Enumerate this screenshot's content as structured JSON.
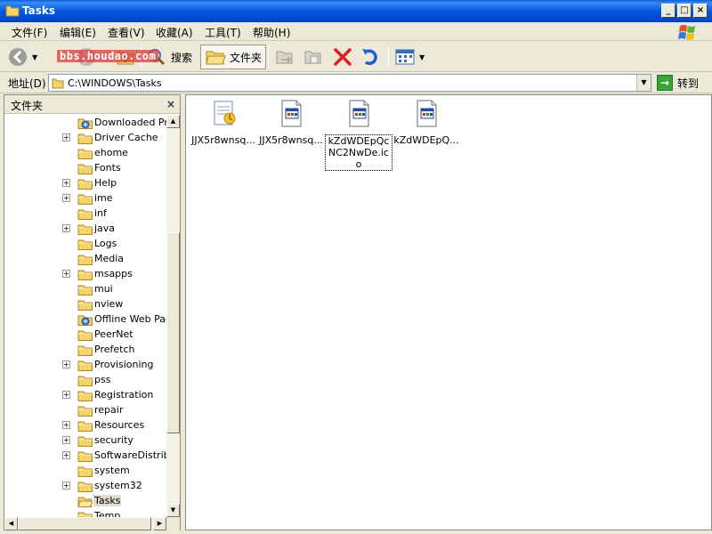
{
  "window": {
    "title": "Tasks"
  },
  "watermark": {
    "text": "bbs.houdao.com"
  },
  "menu": [
    {
      "label": "文件(F)"
    },
    {
      "label": "编辑(E)"
    },
    {
      "label": "查看(V)"
    },
    {
      "label": "收藏(A)"
    },
    {
      "label": "工具(T)"
    },
    {
      "label": "帮助(H)"
    }
  ],
  "toolbar": {
    "search_label": "搜索",
    "folders_label": "文件夹"
  },
  "address": {
    "label": "地址(D)",
    "path": "C:\\WINDOWS\\Tasks",
    "go_label": "转到"
  },
  "folder_pane": {
    "title": "文件夹",
    "items": [
      {
        "name": "Downloaded Program Files",
        "expander": "",
        "icon": "special"
      },
      {
        "name": "Driver Cache",
        "expander": "+",
        "icon": "folder"
      },
      {
        "name": "ehome",
        "expander": "",
        "icon": "folder"
      },
      {
        "name": "Fonts",
        "expander": "",
        "icon": "folder"
      },
      {
        "name": "Help",
        "expander": "+",
        "icon": "folder"
      },
      {
        "name": "ime",
        "expander": "+",
        "icon": "folder"
      },
      {
        "name": "inf",
        "expander": "",
        "icon": "folder"
      },
      {
        "name": "java",
        "expander": "+",
        "icon": "folder"
      },
      {
        "name": "Logs",
        "expander": "",
        "icon": "folder"
      },
      {
        "name": "Media",
        "expander": "",
        "icon": "folder"
      },
      {
        "name": "msapps",
        "expander": "+",
        "icon": "folder"
      },
      {
        "name": "mui",
        "expander": "",
        "icon": "folder"
      },
      {
        "name": "nview",
        "expander": "",
        "icon": "folder"
      },
      {
        "name": "Offline Web Pages",
        "expander": "",
        "icon": "special"
      },
      {
        "name": "PeerNet",
        "expander": "",
        "icon": "folder"
      },
      {
        "name": "Prefetch",
        "expander": "",
        "icon": "folder"
      },
      {
        "name": "Provisioning",
        "expander": "+",
        "icon": "folder"
      },
      {
        "name": "pss",
        "expander": "",
        "icon": "folder"
      },
      {
        "name": "Registration",
        "expander": "+",
        "icon": "folder"
      },
      {
        "name": "repair",
        "expander": "",
        "icon": "folder"
      },
      {
        "name": "Resources",
        "expander": "+",
        "icon": "folder"
      },
      {
        "name": "security",
        "expander": "+",
        "icon": "folder"
      },
      {
        "name": "SoftwareDistribution",
        "expander": "+",
        "icon": "folder"
      },
      {
        "name": "system",
        "expander": "",
        "icon": "folder"
      },
      {
        "name": "system32",
        "expander": "+",
        "icon": "folder"
      },
      {
        "name": "Tasks",
        "expander": "",
        "icon": "open-folder",
        "selected": true
      },
      {
        "name": "Temp",
        "expander": "",
        "icon": "folder"
      }
    ]
  },
  "files": [
    {
      "label": "JJX5r8wnsq...",
      "icon": "scheduled-task"
    },
    {
      "label": "JJX5r8wnsq...",
      "icon": "ico-file"
    },
    {
      "label": "kZdWDEpQcNC2NwDe.ico",
      "icon": "ico-file",
      "focused": true
    },
    {
      "label": "kZdWDEpQ...",
      "icon": "ico-file"
    }
  ]
}
